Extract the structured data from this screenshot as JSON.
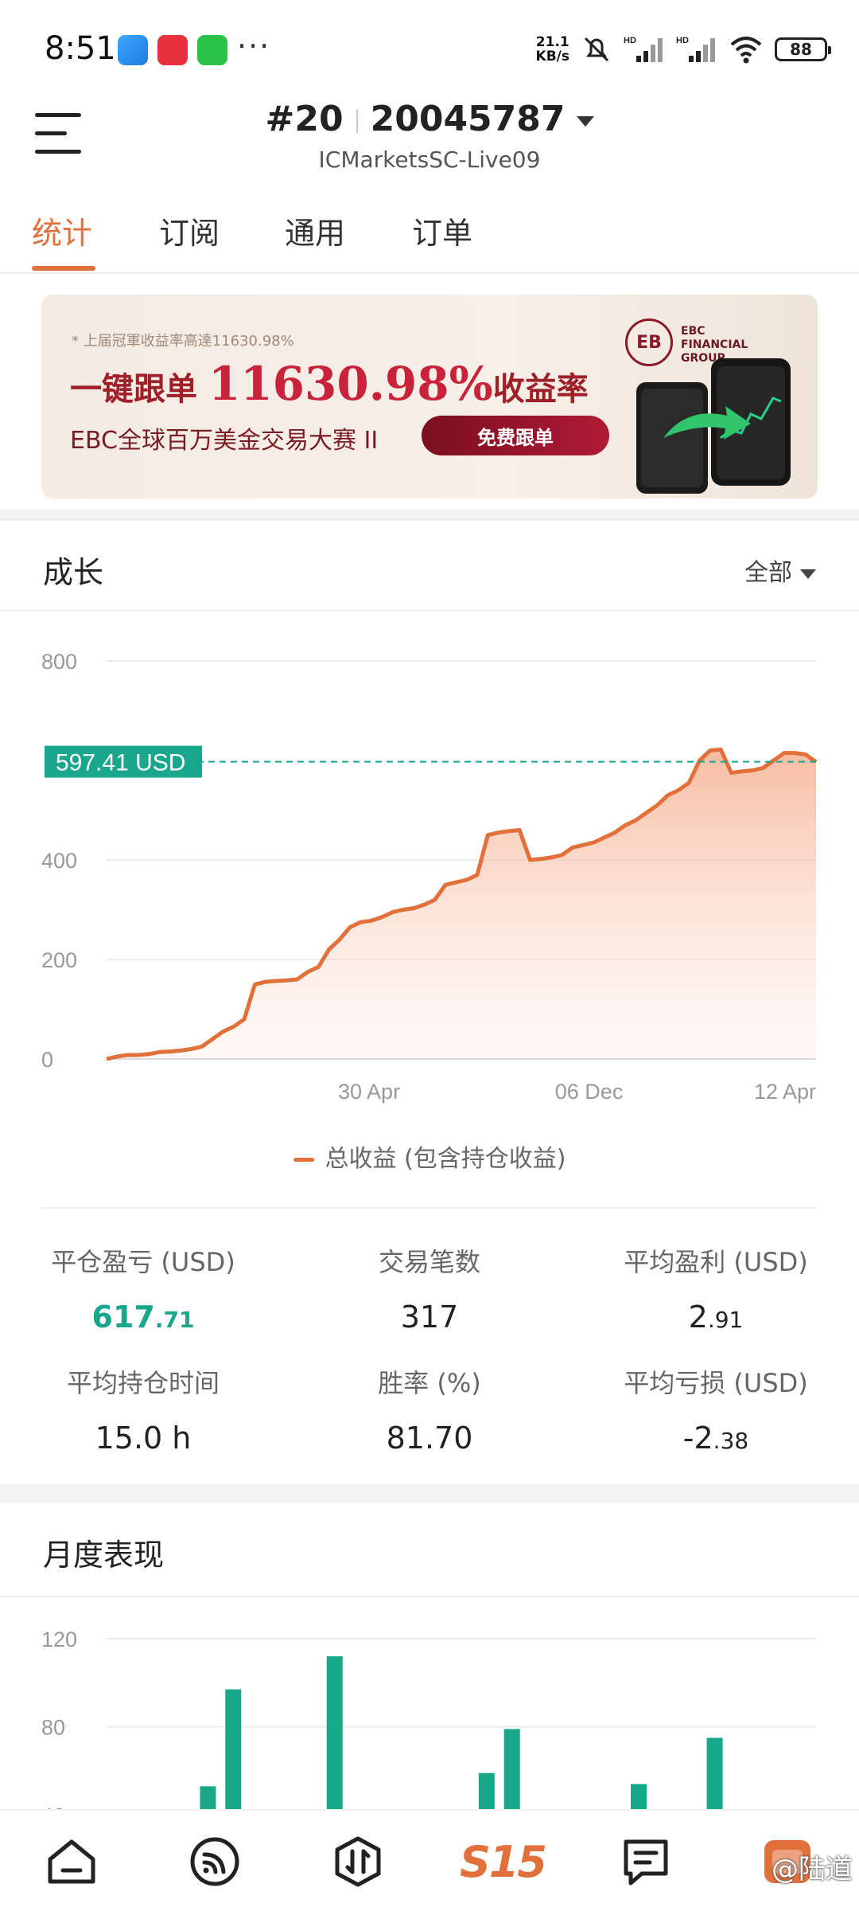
{
  "status_bar": {
    "time": "8:51",
    "net_speed_value": "21.1",
    "net_speed_unit": "KB/s",
    "battery": "88",
    "more": "···"
  },
  "header": {
    "rank": "#20",
    "account_id": "20045787",
    "server": "ICMarketsSC-Live09"
  },
  "tabs": [
    {
      "label": "统计",
      "active": true
    },
    {
      "label": "订阅",
      "active": false
    },
    {
      "label": "通用",
      "active": false
    },
    {
      "label": "订单",
      "active": false
    }
  ],
  "banner": {
    "small_text": "* 上届冠軍收益率高達11630.98%",
    "main_prefix": "一键跟单",
    "main_number": "11630.98%",
    "main_suffix": "收益率",
    "subtitle": "EBC全球百万美金交易大赛 II",
    "button": "免费跟单",
    "brand_mark": "EB",
    "brand_line1": "EBC",
    "brand_line2": "FINANCIAL",
    "brand_line3": "GROUP"
  },
  "growth": {
    "title": "成长",
    "filter": "全部"
  },
  "chart_data": [
    {
      "type": "area",
      "title": "",
      "ylim": [
        0,
        800
      ],
      "yticks": [
        0,
        200,
        400,
        800
      ],
      "xticks": [
        "30 Apr",
        "06 Dec",
        "12 Apr"
      ],
      "current_value_label": "597.41 USD",
      "current_value": 597.41,
      "series": [
        {
          "name": "总收益 (包含持仓收益)",
          "color": "#e2703a",
          "values": [
            0,
            5,
            8,
            8,
            10,
            14,
            15,
            17,
            20,
            25,
            40,
            55,
            65,
            80,
            150,
            155,
            157,
            158,
            160,
            175,
            185,
            220,
            240,
            265,
            275,
            278,
            285,
            295,
            300,
            303,
            310,
            320,
            350,
            355,
            360,
            370,
            450,
            455,
            458,
            460,
            400,
            402,
            405,
            410,
            425,
            430,
            435,
            445,
            455,
            470,
            480,
            495,
            510,
            530,
            540,
            555,
            600,
            620,
            622,
            575,
            578,
            580,
            585,
            600,
            615,
            615,
            612,
            597
          ]
        }
      ]
    },
    {
      "type": "bar",
      "title": "",
      "ylim": [
        0,
        120
      ],
      "yticks": [
        40,
        80,
        120
      ],
      "series": [
        {
          "name": "",
          "color": "#17a88a",
          "values": [
            0,
            0,
            0,
            0,
            53,
            97,
            0,
            0,
            0,
            112,
            0,
            0,
            0,
            0,
            0,
            59,
            79,
            0,
            0,
            0,
            0,
            54,
            0,
            0,
            75,
            0,
            0,
            0,
            42
          ]
        }
      ]
    }
  ],
  "stats": [
    {
      "label": "平仓盈亏 (USD)",
      "int": "617",
      "dec": ".71",
      "green": true
    },
    {
      "label": "交易笔数",
      "int": "317",
      "dec": "",
      "green": false
    },
    {
      "label": "平均盈利 (USD)",
      "int": "2",
      "dec": ".91",
      "green": false
    },
    {
      "label": "平均持仓时间",
      "int": "15.0 h",
      "dec": "",
      "green": false
    },
    {
      "label": "胜率 (%)",
      "int": "81.70",
      "dec": "",
      "green": false
    },
    {
      "label": "平均亏损 (USD)",
      "int": "-2",
      "dec": ".38",
      "green": false
    }
  ],
  "monthly": {
    "title": "月度表现"
  },
  "bottom_nav": [
    {
      "icon": "home-icon"
    },
    {
      "icon": "signal-icon"
    },
    {
      "icon": "trade-icon"
    },
    {
      "label": "S15"
    },
    {
      "icon": "message-icon"
    },
    {
      "icon": "profile-icon"
    }
  ],
  "watermark": "@陆道",
  "colors": {
    "accent": "#e2703a",
    "green": "#17a88a",
    "price_tag": "#1aa58d"
  }
}
